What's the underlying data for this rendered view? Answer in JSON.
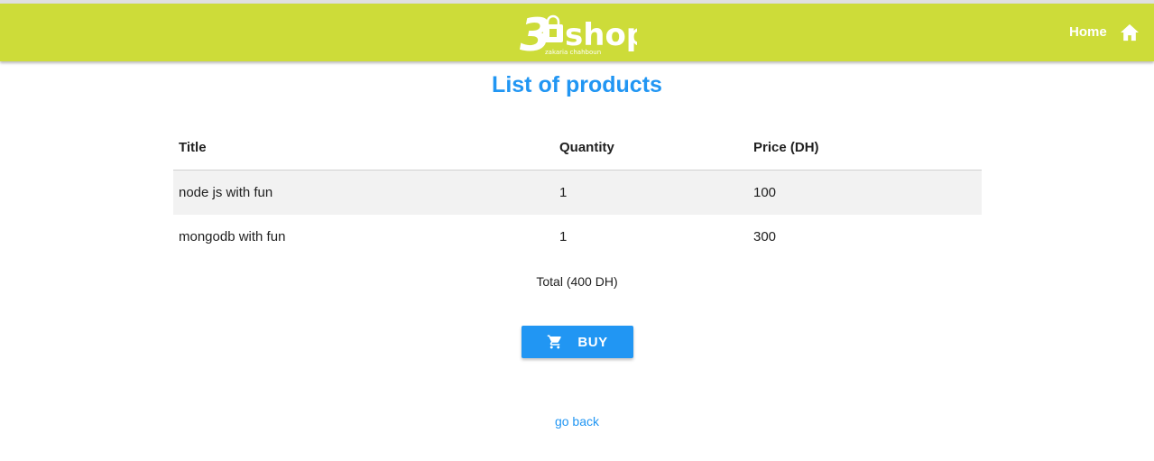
{
  "navbar": {
    "background": "#cddc39",
    "logo": {
      "main_text": "shop",
      "mark_text": "3",
      "tagline": "zakaria chahboun"
    },
    "home_label": "Home",
    "home_icon": "home-icon"
  },
  "page": {
    "title": "List of products",
    "accent": "#2196f3"
  },
  "table": {
    "headers": [
      "Title",
      "Quantity",
      "Price (DH)"
    ],
    "rows": [
      {
        "title": "node js with fun",
        "quantity": "1",
        "price": "100"
      },
      {
        "title": "mongodb with fun",
        "quantity": "1",
        "price": "300"
      }
    ]
  },
  "summary": {
    "total": "Total (400 DH)"
  },
  "actions": {
    "buy_label": "BUY",
    "buy_icon": "shopping-cart-icon",
    "back_label": "go back"
  }
}
